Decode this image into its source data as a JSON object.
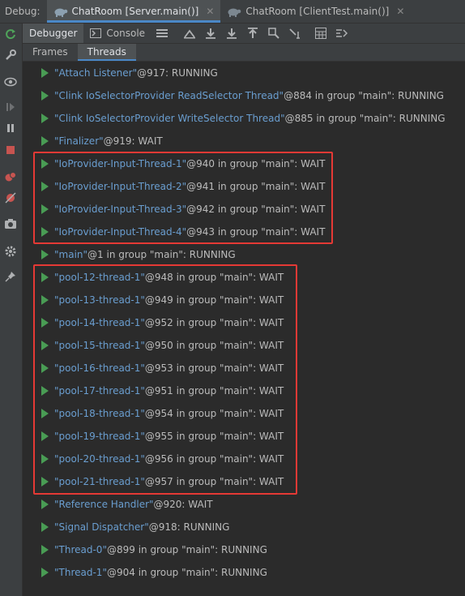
{
  "header": {
    "debug_label": "Debug:",
    "tabs": [
      {
        "label": "ChatRoom [Server.main()]",
        "active": true
      },
      {
        "label": "ChatRoom [ClientTest.main()]",
        "active": false
      }
    ]
  },
  "toolbar": {
    "debugger_label": "Debugger",
    "console_label": "Console"
  },
  "subtabs": {
    "frames_label": "Frames",
    "threads_label": "Threads"
  },
  "threads": [
    {
      "name": "\"Attach Listener\"",
      "rest": "@917: RUNNING"
    },
    {
      "name": "\"Clink IoSelectorProvider ReadSelector Thread\"",
      "rest": "@884 in group \"main\": RUNNING"
    },
    {
      "name": "\"Clink IoSelectorProvider WriteSelector Thread\"",
      "rest": "@885 in group \"main\": RUNNING"
    },
    {
      "name": "\"Finalizer\"",
      "rest": "@919: WAIT"
    },
    {
      "name": "\"IoProvider-Input-Thread-1\"",
      "rest": "@940 in group \"main\": WAIT"
    },
    {
      "name": "\"IoProvider-Input-Thread-2\"",
      "rest": "@941 in group \"main\": WAIT"
    },
    {
      "name": "\"IoProvider-Input-Thread-3\"",
      "rest": "@942 in group \"main\": WAIT"
    },
    {
      "name": "\"IoProvider-Input-Thread-4\"",
      "rest": "@943 in group \"main\": WAIT"
    },
    {
      "name": "\"main\"",
      "rest": "@1 in group \"main\": RUNNING"
    },
    {
      "name": "\"pool-12-thread-1\"",
      "rest": "@948 in group \"main\": WAIT"
    },
    {
      "name": "\"pool-13-thread-1\"",
      "rest": "@949 in group \"main\": WAIT"
    },
    {
      "name": "\"pool-14-thread-1\"",
      "rest": "@952 in group \"main\": WAIT"
    },
    {
      "name": "\"pool-15-thread-1\"",
      "rest": "@950 in group \"main\": WAIT"
    },
    {
      "name": "\"pool-16-thread-1\"",
      "rest": "@953 in group \"main\": WAIT"
    },
    {
      "name": "\"pool-17-thread-1\"",
      "rest": "@951 in group \"main\": WAIT"
    },
    {
      "name": "\"pool-18-thread-1\"",
      "rest": "@954 in group \"main\": WAIT"
    },
    {
      "name": "\"pool-19-thread-1\"",
      "rest": "@955 in group \"main\": WAIT"
    },
    {
      "name": "\"pool-20-thread-1\"",
      "rest": "@956 in group \"main\": WAIT"
    },
    {
      "name": "\"pool-21-thread-1\"",
      "rest": "@957 in group \"main\": WAIT"
    },
    {
      "name": "\"Reference Handler\"",
      "rest": "@920: WAIT"
    },
    {
      "name": "\"Signal Dispatcher\"",
      "rest": "@918: RUNNING"
    },
    {
      "name": "\"Thread-0\"",
      "rest": "@899 in group \"main\": RUNNING"
    },
    {
      "name": "\"Thread-1\"",
      "rest": "@904 in group \"main\": RUNNING"
    }
  ],
  "colors": {
    "background": "#2b2b2b",
    "panel": "#3c3f41",
    "thread_name": "#6a9ed0",
    "play_icon": "#499c54",
    "highlight_box": "#e53935",
    "active_tab_accent": "#4a88c7"
  }
}
